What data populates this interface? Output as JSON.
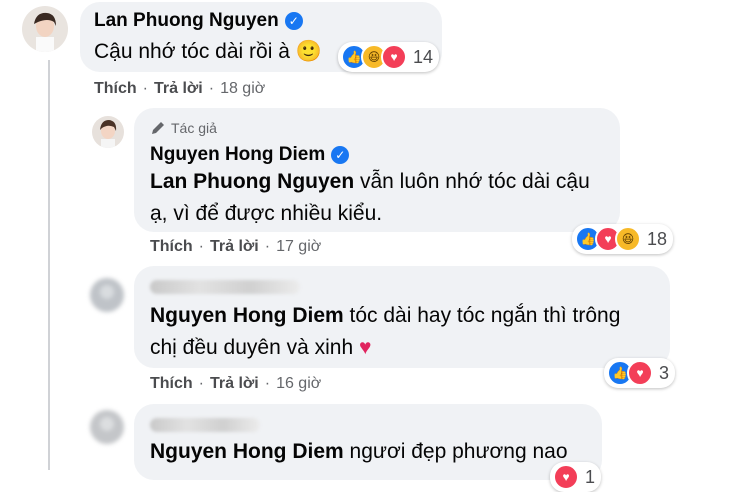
{
  "comments": [
    {
      "name": "Lan Phuong Nguyen",
      "text": "Cậu nhớ tóc dài rồi à",
      "emoji": "🙂",
      "reaction_count": "14",
      "like_label": "Thích",
      "reply_label": "Trả lời",
      "time": "18 giờ"
    },
    {
      "author_tag": "Tác giả",
      "name": "Nguyen Hong Diem",
      "mention": "Lan Phuong Nguyen",
      "text": " vẫn luôn nhớ tóc dài cậu ạ, vì để được nhiều kiểu.",
      "reaction_count": "18",
      "like_label": "Thích",
      "reply_label": "Trả lời",
      "time": "17 giờ"
    },
    {
      "mention": "Nguyen Hong Diem",
      "text": " tóc dài hay tóc ngắn thì trông chị đều duyên và xinh",
      "emoji": "❤️",
      "reaction_count": "3",
      "like_label": "Thích",
      "reply_label": "Trả lời",
      "time": "16 giờ"
    },
    {
      "mention": "Nguyen Hong Diem",
      "text": " ngươi đẹp phương nao",
      "reaction_count": "1"
    }
  ],
  "colors": {
    "bubble": "#f0f2f5",
    "like": "#1877f2",
    "love": "#f33e58",
    "haha": "#f7b928"
  },
  "icons": [
    "verified-badge-icon",
    "pencil-icon",
    "like-reaction-icon",
    "love-reaction-icon",
    "haha-reaction-icon"
  ]
}
